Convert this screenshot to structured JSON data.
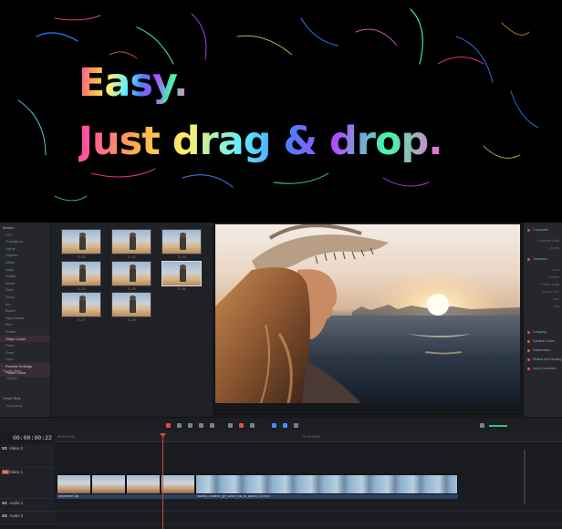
{
  "hero": {
    "line1": "Easy.",
    "line2": "Just drag & drop.",
    "gradient_colors": [
      "#ff3fae",
      "#ffb347",
      "#fff06a",
      "#5ff0ff",
      "#4f7dff",
      "#b04bff",
      "#3fffa8"
    ]
  },
  "media_tree": {
    "items": [
      "Master",
      "VFX",
      "Transitions",
      "Lights",
      "Ripples",
      "Glitch",
      "Warp",
      "Shake",
      "Wave",
      "Swirl",
      "Zoom",
      "Iris",
      "Bokeh",
      "Light Leaks",
      "Blur",
      "Frame",
      "Stripe Lower",
      "Flash",
      "Push",
      "Spin",
      "Presets Settings",
      "Power Lines"
    ],
    "active_item": "Stripe Lower",
    "power_bins_label": "Power Bins",
    "power_bins_item": "Master",
    "smart_bins_label": "Smart Bins",
    "smart_bins_item": "Keywords"
  },
  "thumbnails": {
    "labels": [
      "TL-01",
      "TL-02",
      "TL-03",
      "TL-04",
      "TL-05",
      "TL-06",
      "TL-07",
      "TL-08"
    ],
    "selected_index": 5
  },
  "inspector": {
    "sections": [
      "Composite",
      "Transform",
      "Cropping",
      "Dynamic Zoom",
      "Stabilization",
      "Retime And Scaling",
      "Lens Correction"
    ],
    "sub_rows": [
      "Composite Mode",
      "Opacity",
      "Zoom",
      "Position",
      "Rotation Angle",
      "Anchor Point",
      "Pitch",
      "Yaw"
    ]
  },
  "timeline": {
    "timecode": "00:00:00:22",
    "ruler_start": "00:00:00:00",
    "ruler_mark": "00:00:08:00",
    "tracks": [
      {
        "id": "V2",
        "name": "Video 2"
      },
      {
        "id": "V1",
        "name": "Video 1"
      },
      {
        "id": "A1",
        "name": "Audio 1"
      },
      {
        "id": "A2",
        "name": "Audio 2"
      }
    ],
    "clip_a_name": "Adjustment Clip",
    "clip_b_name": "Istanbul_coastline_girl_sunset_hat_4k_graded_v02.mp4"
  },
  "colors": {
    "accent_red": "#e0503c",
    "accent_blue": "#4a8cff",
    "active_item_bg": "#3a2c33"
  }
}
